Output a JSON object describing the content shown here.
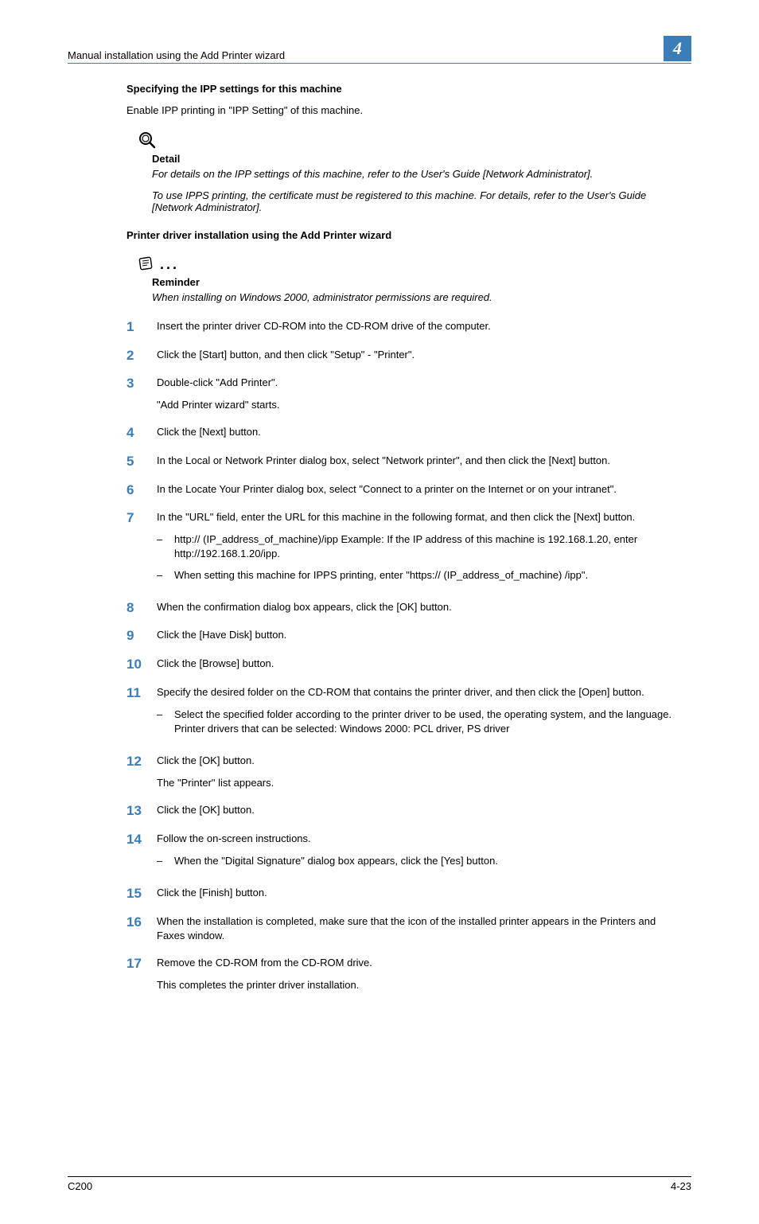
{
  "header": {
    "title": "Manual installation using the Add Printer wizard",
    "chapter": "4"
  },
  "section1": {
    "heading": "Specifying the IPP settings for this machine",
    "body": "Enable IPP printing in \"IPP Setting\" of this machine."
  },
  "detail_note": {
    "label": "Detail",
    "p1": "For details on the IPP settings of this machine, refer to the User's Guide [Network Administrator].",
    "p2": "To use IPPS printing, the certificate must be registered to this machine. For details, refer to the User's Guide [Network Administrator]."
  },
  "section2": {
    "heading": "Printer driver installation using the Add Printer wizard"
  },
  "reminder_note": {
    "label": "Reminder",
    "p1": "When installing on Windows 2000, administrator permissions are required."
  },
  "steps": [
    {
      "n": "1",
      "body": [
        "Insert the printer driver CD-ROM into the CD-ROM drive of the computer."
      ]
    },
    {
      "n": "2",
      "body": [
        "Click the [Start] button, and then click \"Setup\" - \"Printer\"."
      ]
    },
    {
      "n": "3",
      "body": [
        "Double-click \"Add Printer\".",
        "\"Add Printer wizard\" starts."
      ]
    },
    {
      "n": "4",
      "body": [
        "Click the [Next] button."
      ]
    },
    {
      "n": "5",
      "body": [
        "In the Local or Network Printer dialog box, select \"Network printer\", and then click the [Next] button."
      ]
    },
    {
      "n": "6",
      "body": [
        "In the Locate Your Printer dialog box, select \"Connect to a printer on the Internet or on your intranet\"."
      ]
    },
    {
      "n": "7",
      "body": [
        "In the \"URL\" field, enter the URL for this machine in the following format, and then click the [Next] button."
      ],
      "subs": [
        "http:// (IP_address_of_machine)/ipp Example: If the IP address of this machine is 192.168.1.20, enter http://192.168.1.20/ipp.",
        "When setting this machine for IPPS printing, enter \"https:// (IP_address_of_machine) /ipp\"."
      ]
    },
    {
      "n": "8",
      "body": [
        "When the confirmation dialog box appears, click the [OK] button."
      ]
    },
    {
      "n": "9",
      "body": [
        "Click the [Have Disk] button."
      ]
    },
    {
      "n": "10",
      "body": [
        "Click the [Browse] button."
      ]
    },
    {
      "n": "11",
      "body": [
        "Specify the desired folder on the CD-ROM that contains the printer driver, and then click the [Open] button."
      ],
      "subs": [
        "Select the specified folder according to the printer driver to be used, the operating system, and the language. Printer drivers that can be selected: Windows 2000: PCL driver, PS driver"
      ]
    },
    {
      "n": "12",
      "body": [
        "Click the [OK] button.",
        "The \"Printer\" list appears."
      ]
    },
    {
      "n": "13",
      "body": [
        "Click the [OK] button."
      ]
    },
    {
      "n": "14",
      "body": [
        "Follow the on-screen instructions."
      ],
      "subs": [
        "When the \"Digital Signature\" dialog box appears, click the [Yes] button."
      ]
    },
    {
      "n": "15",
      "body": [
        "Click the [Finish] button."
      ]
    },
    {
      "n": "16",
      "body": [
        "When the installation is completed, make sure that the icon of the installed printer appears in the Printers and Faxes window."
      ]
    },
    {
      "n": "17",
      "body": [
        "Remove the CD-ROM from the CD-ROM drive.",
        "This completes the printer driver installation."
      ]
    }
  ],
  "footer": {
    "left": "C200",
    "right": "4-23"
  }
}
